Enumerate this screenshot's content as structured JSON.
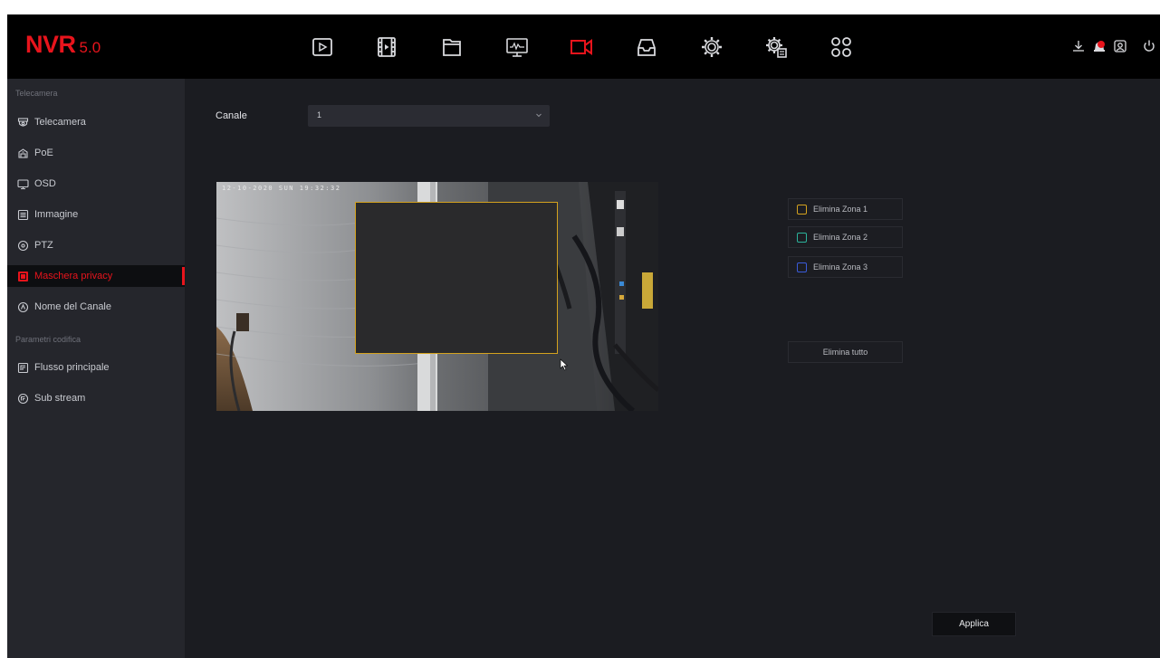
{
  "app": {
    "logo_main": "NVR",
    "logo_version": "5.0"
  },
  "topnav": [
    {
      "name": "playback-icon",
      "active": false
    },
    {
      "name": "video-clips-icon",
      "active": false
    },
    {
      "name": "files-icon",
      "active": false
    },
    {
      "name": "monitor-icon",
      "active": false
    },
    {
      "name": "camera-icon",
      "active": true
    },
    {
      "name": "storage-icon",
      "active": false
    },
    {
      "name": "settings-icon",
      "active": false
    },
    {
      "name": "system-settings-icon",
      "active": false
    },
    {
      "name": "apps-grid-icon",
      "active": false
    }
  ],
  "topright": [
    "download-icon",
    "alarm-icon",
    "user-icon",
    "power-icon"
  ],
  "sidebar": {
    "section1": "Telecamera",
    "items1": [
      {
        "label": "Telecamera",
        "icon": "camera-icon"
      },
      {
        "label": "PoE",
        "icon": "poe-icon"
      },
      {
        "label": "OSD",
        "icon": "osd-icon"
      },
      {
        "label": "Immagine",
        "icon": "image-icon"
      },
      {
        "label": "PTZ",
        "icon": "ptz-icon"
      },
      {
        "label": "Maschera privacy",
        "icon": "privacy-mask-icon",
        "active": true
      },
      {
        "label": "Nome del Canale",
        "icon": "channel-name-icon"
      }
    ],
    "section2": "Parametri codifica",
    "items2": [
      {
        "label": "Flusso principale",
        "icon": "main-stream-icon"
      },
      {
        "label": "Sub stream",
        "icon": "sub-stream-icon"
      }
    ]
  },
  "content": {
    "channel_label": "Canale",
    "channel_value": "1",
    "osd_text": "12-10-2020 SUN 19:32:32",
    "zones": [
      {
        "label": "Elimina Zona 1",
        "color": "#d4a21e"
      },
      {
        "label": "Elimina Zona 2",
        "color": "#2bb39b"
      },
      {
        "label": "Elimina Zona 3",
        "color": "#3a5bd9"
      }
    ],
    "delete_all": "Elimina tutto",
    "apply": "Applica"
  },
  "colors": {
    "accent": "#e8141c",
    "background": "#1b1c21",
    "sidebar": "#25262c",
    "topbar": "#000000"
  }
}
